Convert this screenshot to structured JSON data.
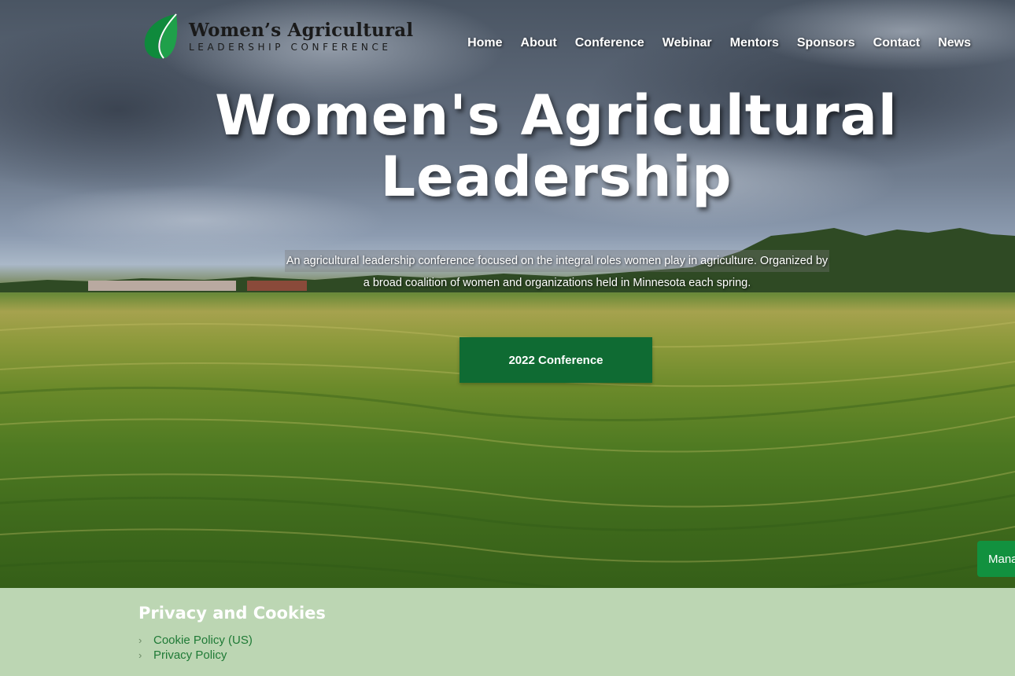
{
  "site": {
    "logo_title": "Women’s Agricultural",
    "logo_subtitle": "LEADERSHIP CONFERENCE"
  },
  "nav": {
    "items": [
      "Home",
      "About",
      "Conference",
      "Webinar",
      "Mentors",
      "Sponsors",
      "Contact",
      "News"
    ]
  },
  "hero": {
    "headline_line1": "Women's Agricultural",
    "headline_line2": "Leadership",
    "tagline_line1": "An agricultural leadership conference focused on the integral roles women play in agriculture. Organized by",
    "tagline_line2": "a broad coalition of women and organizations held in Minnesota each spring.",
    "cta_label": "2022 Conference"
  },
  "consent": {
    "manage_label": "Manage"
  },
  "footer": {
    "heading": "Privacy and Cookies",
    "links": [
      "Cookie Policy (US)",
      "Privacy Policy"
    ]
  },
  "colors": {
    "brand_green": "#0f6b33",
    "consent_green": "#12913f",
    "footer_bg": "#bcd6b3",
    "link_green": "#1f7a36"
  }
}
